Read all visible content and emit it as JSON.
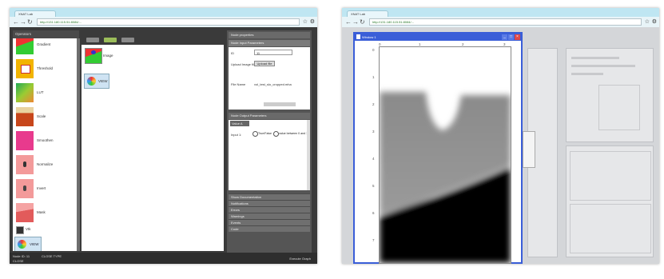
{
  "left_screenshot": {
    "tab_title": "XNAT Lab",
    "url": "http://131.180.115.51:8084/...",
    "palette": {
      "header": "Operators",
      "items": [
        {
          "label": "Gradient",
          "thumb": "gradient-thumb"
        },
        {
          "label": "Threshold",
          "thumb": "threshold-thumb"
        },
        {
          "label": "LUT",
          "thumb": "lut-thumb"
        },
        {
          "label": "Scale",
          "thumb": "scale-thumb"
        },
        {
          "label": "Smoothen",
          "thumb": "smoothen-thumb"
        },
        {
          "label": "Normalize",
          "thumb": "normalize-thumb"
        },
        {
          "label": "Invert",
          "thumb": "invert-thumb"
        },
        {
          "label": "Mask",
          "thumb": "mask-thumb"
        },
        {
          "label": "Vtk",
          "thumb": "vtk-thumb"
        }
      ],
      "view_label": "VIEW"
    },
    "canvas": {
      "nodes": [
        {
          "label": "Image"
        },
        {
          "label": "VIEW"
        }
      ]
    },
    "properties": {
      "header": "Node properties",
      "subheader": "Node Input Parameters",
      "rows": [
        {
          "label": "ID",
          "value": "11"
        },
        {
          "label": "Upload Image file",
          "button": "Upload file"
        },
        {
          "label": "File Name",
          "value": "vol_test_slo_cropped.mha"
        }
      ]
    },
    "output_panel": {
      "header": "Node Output Parameters",
      "tab": "Value A",
      "row_label": "Input 1:",
      "radio1": "True/False",
      "radio2": "value between 0 and 1"
    },
    "accordion": [
      "Show Documentation",
      "Notifications",
      "Errors",
      "Warnings",
      "Events",
      "Code"
    ],
    "status": {
      "left1": "Node ID: 11",
      "left2": "CLOSE",
      "middle": "CLOSE TYPE",
      "right": "Execute Graph"
    }
  },
  "right_screenshot": {
    "tab_title": "XNAT Lab",
    "url": "http://131.180.115.51:8084/...",
    "window": {
      "title": "Window 1",
      "x_ticks": [
        "0",
        "1",
        "2",
        "3"
      ],
      "y_ticks": [
        "0",
        "1",
        "2",
        "3",
        "4",
        "5",
        "6",
        "7"
      ]
    }
  },
  "colors": {
    "chrome_titlebar": "#bfe6f2",
    "window_border": "#3a5ed8",
    "app_dark": "#3a3a3a"
  }
}
